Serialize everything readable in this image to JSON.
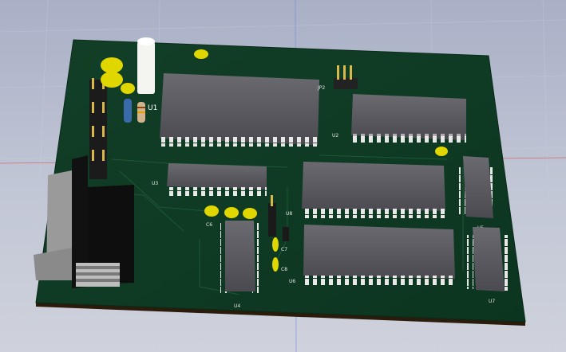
{
  "viewer": {
    "background_color": "#b9bfd0",
    "board_color": "#0f3a22",
    "chip_color": "#55555a"
  },
  "labels": {
    "u1": "U1",
    "u2": "U2",
    "u3": "U3",
    "u4": "U4",
    "u5": "U5",
    "u6": "U6",
    "u7": "U7",
    "u8": "U8",
    "c6": "C6",
    "c7": "C7",
    "c8": "C8",
    "jp2": "JP2"
  }
}
